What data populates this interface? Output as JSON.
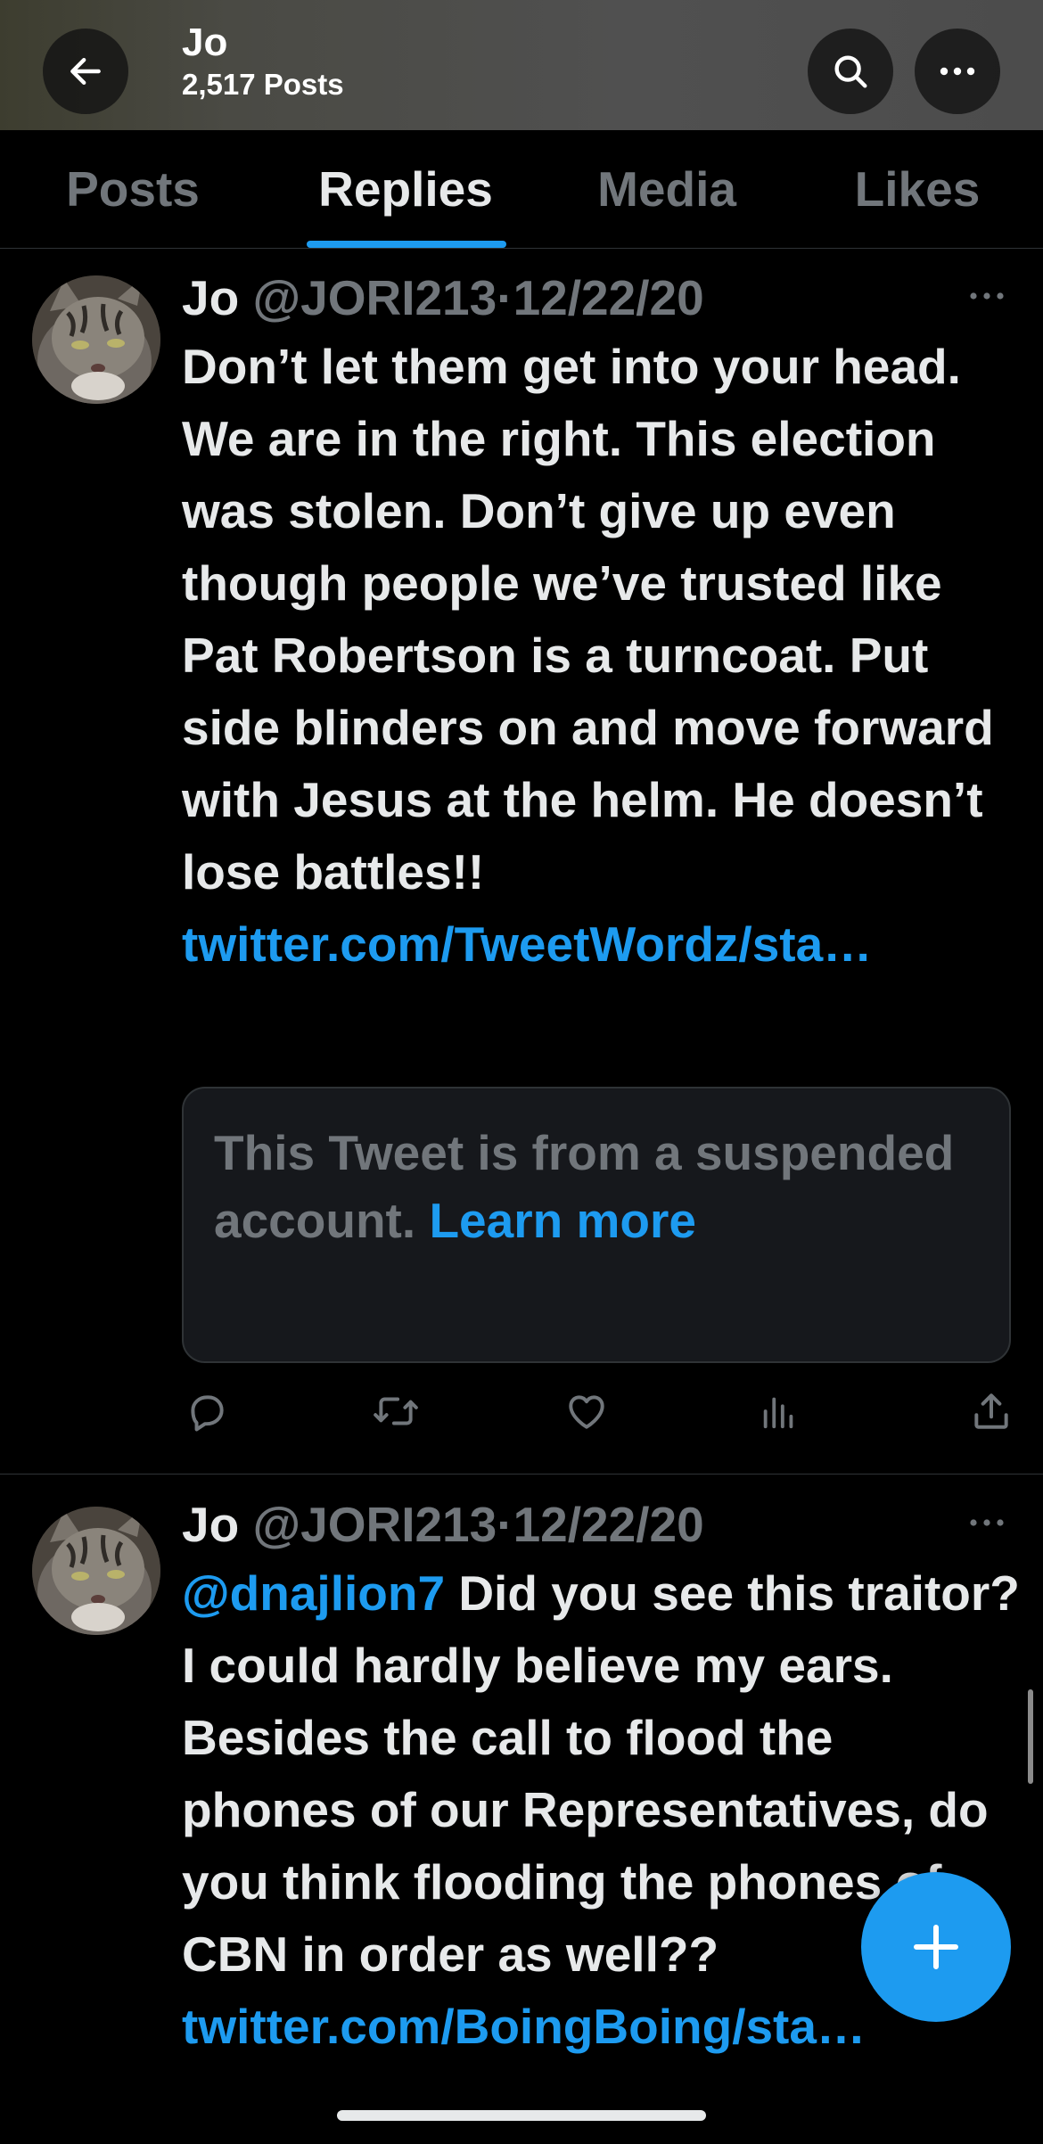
{
  "header": {
    "title": "Jo",
    "post_count": "2,517 Posts",
    "back_icon": "arrow-left-icon",
    "search_icon": "search-icon",
    "more_icon": "more-horizontal-icon"
  },
  "tabs": [
    {
      "label": "Posts",
      "active": false
    },
    {
      "label": "Replies",
      "active": true
    },
    {
      "label": "Media",
      "active": false
    },
    {
      "label": "Likes",
      "active": false
    }
  ],
  "colors": {
    "accent": "#1d9bf0",
    "background": "#000000",
    "text_primary": "#e7e9ea",
    "text_secondary": "#71767b"
  },
  "tweets": [
    {
      "name": "Jo",
      "handle": "@JORI213",
      "separator": "·",
      "date": "12/22/20",
      "text": "Don’t let them get into your head. We are in the right. This election was stolen. Don’t give up even though people we’ve trusted like Pat Robertson is a turncoat. Put side blinders on and move forward with Jesus at the helm. He doesn’t lose battles!! ",
      "link": "twitter.com/TweetWordz/sta…",
      "quote": {
        "text": "This Tweet is from a suspended account. ",
        "link": "Learn more"
      }
    },
    {
      "name": "Jo",
      "handle": "@JORI213",
      "separator": "·",
      "date": "12/22/20",
      "mention": "@dnajlion7",
      "text": " Did you see this traitor? I could hardly believe my ears. Besides the call to flood the phones of our Representatives, do you think flooding the phones of CBN in order as well?? ",
      "link": "twitter.com/BoingBoing/sta…"
    }
  ],
  "actions": [
    "reply-icon",
    "retweet-icon",
    "like-icon",
    "views-icon",
    "share-icon"
  ],
  "fab": {
    "icon": "compose-plus-icon"
  }
}
